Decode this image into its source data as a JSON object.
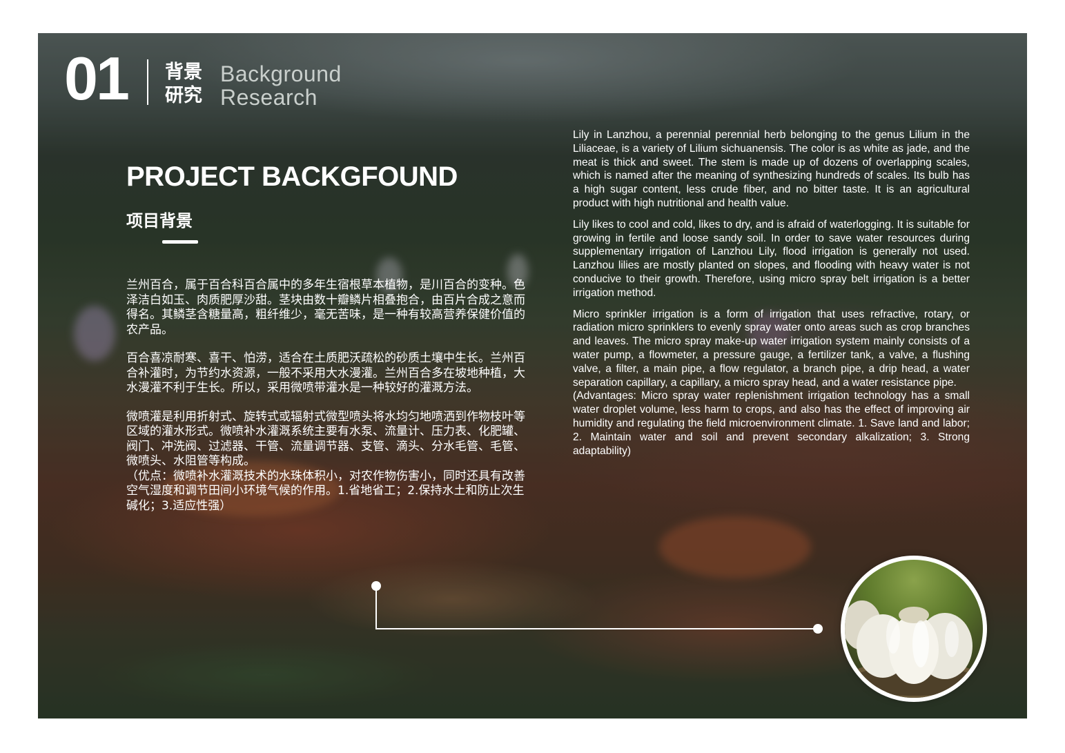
{
  "header": {
    "number": "01",
    "cn_line1": "背景",
    "cn_line2": "研究",
    "en_line1": "Background",
    "en_line2": "Research"
  },
  "title": {
    "main": "PROJECT BACKGFOUND",
    "sub": "项目背景"
  },
  "cn_paragraphs": {
    "p1": "兰州百合，属于百合科百合属中的多年生宿根草本植物，是川百合的变种。色泽洁白如玉、肉质肥厚沙甜。茎块由数十瓣鳞片相叠抱合，由百片合成之意而得名。其鳞茎含糖量高，粗纤维少，毫无苦味，是一种有较高营养保健价值的农产品。",
    "p2": "百合喜凉耐寒、喜干、怕涝，适合在土质肥沃疏松的砂质土壤中生长。兰州百合补灌时，为节约水资源，一般不采用大水漫灌。兰州百合多在坡地种植，大水漫灌不利于生长。所以，采用微喷带灌水是一种较好的灌溉方法。",
    "p3": "微喷灌是利用折射式、旋转式或辐射式微型喷头将水均匀地喷洒到作物枝叶等区域的灌水形式。微喷补水灌溉系统主要有水泵、流量计、压力表、化肥罐、阀门、冲洗阀、过滤器、干管、流量调节器、支管、滴头、分水毛管、毛管、微喷头、水阻管等构成。",
    "p4": "（优点：微喷补水灌溉技术的水珠体积小，对农作物伤害小，同时还具有改善空气湿度和调节田间小环境气候的作用。1.省地省工；2.保持水土和防止次生碱化；3.适应性强）"
  },
  "en_paragraphs": {
    "p1": "Lily in Lanzhou, a perennial perennial herb belonging to the genus Lilium in the Liliaceae, is a variety of Lilium sichuanensis. The color is as white as jade, and the meat is thick and sweet. The stem is made up of dozens of overlapping scales, which is named after the meaning of synthesizing hundreds of scales. Its bulb has a high sugar content, less crude fiber, and no bitter taste. It is an agricultural product with high nutritional and health value.",
    "p2": "Lily likes to cool and cold, likes to dry, and is afraid of waterlogging. It is suitable for growing in fertile and loose sandy soil. In order to save water resources during supplementary irrigation of Lanzhou Lily, flood irrigation is generally not used. Lanzhou lilies are mostly planted on slopes, and flooding with heavy water is not conducive to their growth. Therefore, using micro spray belt irrigation is a better irrigation method.",
    "p3": "Micro sprinkler irrigation is a form of irrigation that uses refractive, rotary, or radiation micro sprinklers to evenly spray water onto areas such as crop branches and leaves. The micro spray make-up water irrigation system mainly consists of a water pump, a flowmeter, a pressure gauge, a fertilizer tank, a valve, a flushing valve, a filter, a main pipe, a flow regulator, a branch pipe, a drip head, a water separation capillary, a capillary, a micro spray head, and a water resistance pipe.",
    "p4": "(Advantages: Micro spray water replenishment irrigation technology has a small water droplet volume, less harm to crops, and also has the effect of improving air humidity and regulating the field microenvironment climate. 1. Save land and labor; 2. Maintain water and soil and prevent secondary alkalization; 3. Strong adaptability)"
  },
  "colors": {
    "text": "#ffffff",
    "accent_line": "#ffffff",
    "sub_heading": "#c9cfcc"
  },
  "images": {
    "background": "blurred-lily-field-photo",
    "inset": "lanzhou-lily-bulb-photo"
  }
}
